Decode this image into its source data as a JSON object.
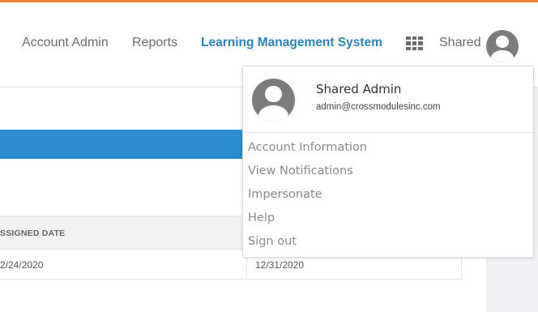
{
  "topnav": {
    "account_admin": "Account Admin",
    "reports": "Reports",
    "lms": "Learning Management System",
    "shared": "Shared"
  },
  "table": {
    "headers": [
      "SSIGNED DATE"
    ],
    "rows": [
      [
        "2/24/2020",
        "12/31/2020"
      ]
    ]
  },
  "dropdown": {
    "name": "Shared Admin",
    "email": "admin@crossmodulesinc.com",
    "items": [
      "Account Information",
      "View Notifications",
      "Impersonate",
      "Help",
      "Sign out"
    ]
  },
  "colors": {
    "accent_orange": "#f0822c",
    "brand_blue": "#2a83b8",
    "banner_blue": "#2a8ccf"
  },
  "icons": [
    "apps-grid-icon",
    "user-avatar-icon"
  ]
}
